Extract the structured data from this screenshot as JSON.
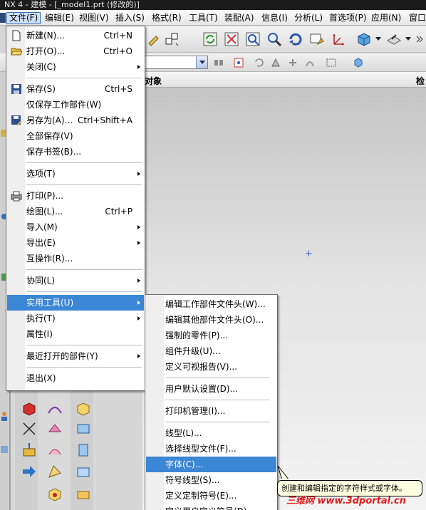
{
  "window": {
    "title": "NX 4 - 建模 - [_model1.prt (修改的)]"
  },
  "menubar": {
    "items": [
      "文件(F)",
      "编辑(E)",
      "视图(V)",
      "插入(S)",
      "格式(R)",
      "工具(T)",
      "装配(A)",
      "信息(I)",
      "分析(L)",
      "首选项(P)",
      "应用(N)",
      "窗口"
    ],
    "active": "文件(F)"
  },
  "file_menu": {
    "items": [
      {
        "label": "新建(N)...",
        "shortcut": "Ctrl+N",
        "icon": "new-file-icon"
      },
      {
        "label": "打开(O)...",
        "shortcut": "Ctrl+O",
        "icon": "open-folder-icon"
      },
      {
        "label": "关闭(C)",
        "submenu": true
      },
      {
        "label": "保存(S)",
        "shortcut": "Ctrl+S",
        "icon": "save-disk-icon"
      },
      {
        "label": "仅保存工作部件(W)"
      },
      {
        "label": "另存为(A)...",
        "shortcut": "Ctrl+Shift+A",
        "icon": "save-as-icon"
      },
      {
        "label": "全部保存(V)"
      },
      {
        "label": "保存书签(B)..."
      },
      {
        "label": "选项(T)",
        "submenu": true
      },
      {
        "label": "打印(P)...",
        "icon": "printer-icon"
      },
      {
        "label": "绘图(L)...",
        "shortcut": "Ctrl+P"
      },
      {
        "label": "导入(M)",
        "submenu": true
      },
      {
        "label": "导出(E)",
        "submenu": true
      },
      {
        "label": "互操作(R)..."
      },
      {
        "label": "协同(L)",
        "submenu": true
      },
      {
        "label": "实用工具(U)",
        "submenu": true,
        "highlighted": true
      },
      {
        "label": "执行(T)",
        "submenu": true
      },
      {
        "label": "属性(I)"
      },
      {
        "label": "最近打开的部件(Y)",
        "submenu": true
      },
      {
        "label": "退出(X)"
      }
    ]
  },
  "utility_menu": {
    "items": [
      {
        "label": "编辑工作部件文件头(W)..."
      },
      {
        "label": "编辑其他部件文件头(O)..."
      },
      {
        "label": "强制的零件(P)..."
      },
      {
        "label": "组件升级(U)..."
      },
      {
        "label": "定义可视报告(V)..."
      },
      {
        "label": "用户默认设置(D)..."
      },
      {
        "label": "打印机管理(I)..."
      },
      {
        "label": "线型(L)..."
      },
      {
        "label": "选择线型文件(F)..."
      },
      {
        "label": "字体(C)...",
        "highlighted": true
      },
      {
        "label": "符号线型(S)..."
      },
      {
        "label": "定义定制符号(E)..."
      },
      {
        "label": "定义用户定义符号(D)..."
      }
    ]
  },
  "tooltip": {
    "text": "创建和编辑指定的字符样式或字体。"
  },
  "navigator": {
    "column_object": "对象",
    "column_right": "检"
  },
  "watermark": {
    "text": "三维网 www.3dportal.cn"
  },
  "colors": {
    "highlight": "#3c86d6",
    "tooltip_bg": "#ffffe1",
    "watermark": "#e01b1b"
  }
}
